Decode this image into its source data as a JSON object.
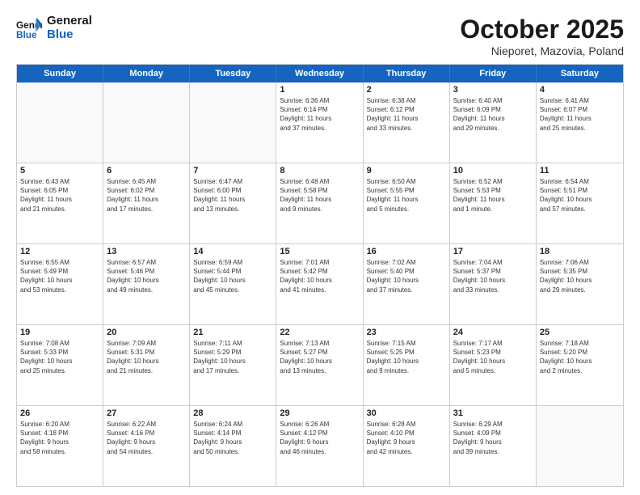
{
  "header": {
    "logo_line1": "General",
    "logo_line2": "Blue",
    "month": "October 2025",
    "location": "Nieporet, Mazovia, Poland"
  },
  "days_of_week": [
    "Sunday",
    "Monday",
    "Tuesday",
    "Wednesday",
    "Thursday",
    "Friday",
    "Saturday"
  ],
  "weeks": [
    [
      {
        "day": "",
        "info": ""
      },
      {
        "day": "",
        "info": ""
      },
      {
        "day": "",
        "info": ""
      },
      {
        "day": "1",
        "info": "Sunrise: 6:36 AM\nSunset: 6:14 PM\nDaylight: 11 hours\nand 37 minutes."
      },
      {
        "day": "2",
        "info": "Sunrise: 6:38 AM\nSunset: 6:12 PM\nDaylight: 11 hours\nand 33 minutes."
      },
      {
        "day": "3",
        "info": "Sunrise: 6:40 AM\nSunset: 6:09 PM\nDaylight: 11 hours\nand 29 minutes."
      },
      {
        "day": "4",
        "info": "Sunrise: 6:41 AM\nSunset: 6:07 PM\nDaylight: 11 hours\nand 25 minutes."
      }
    ],
    [
      {
        "day": "5",
        "info": "Sunrise: 6:43 AM\nSunset: 6:05 PM\nDaylight: 11 hours\nand 21 minutes."
      },
      {
        "day": "6",
        "info": "Sunrise: 6:45 AM\nSunset: 6:02 PM\nDaylight: 11 hours\nand 17 minutes."
      },
      {
        "day": "7",
        "info": "Sunrise: 6:47 AM\nSunset: 6:00 PM\nDaylight: 11 hours\nand 13 minutes."
      },
      {
        "day": "8",
        "info": "Sunrise: 6:48 AM\nSunset: 5:58 PM\nDaylight: 11 hours\nand 9 minutes."
      },
      {
        "day": "9",
        "info": "Sunrise: 6:50 AM\nSunset: 5:55 PM\nDaylight: 11 hours\nand 5 minutes."
      },
      {
        "day": "10",
        "info": "Sunrise: 6:52 AM\nSunset: 5:53 PM\nDaylight: 11 hours\nand 1 minute."
      },
      {
        "day": "11",
        "info": "Sunrise: 6:54 AM\nSunset: 5:51 PM\nDaylight: 10 hours\nand 57 minutes."
      }
    ],
    [
      {
        "day": "12",
        "info": "Sunrise: 6:55 AM\nSunset: 5:49 PM\nDaylight: 10 hours\nand 53 minutes."
      },
      {
        "day": "13",
        "info": "Sunrise: 6:57 AM\nSunset: 5:46 PM\nDaylight: 10 hours\nand 49 minutes."
      },
      {
        "day": "14",
        "info": "Sunrise: 6:59 AM\nSunset: 5:44 PM\nDaylight: 10 hours\nand 45 minutes."
      },
      {
        "day": "15",
        "info": "Sunrise: 7:01 AM\nSunset: 5:42 PM\nDaylight: 10 hours\nand 41 minutes."
      },
      {
        "day": "16",
        "info": "Sunrise: 7:02 AM\nSunset: 5:40 PM\nDaylight: 10 hours\nand 37 minutes."
      },
      {
        "day": "17",
        "info": "Sunrise: 7:04 AM\nSunset: 5:37 PM\nDaylight: 10 hours\nand 33 minutes."
      },
      {
        "day": "18",
        "info": "Sunrise: 7:06 AM\nSunset: 5:35 PM\nDaylight: 10 hours\nand 29 minutes."
      }
    ],
    [
      {
        "day": "19",
        "info": "Sunrise: 7:08 AM\nSunset: 5:33 PM\nDaylight: 10 hours\nand 25 minutes."
      },
      {
        "day": "20",
        "info": "Sunrise: 7:09 AM\nSunset: 5:31 PM\nDaylight: 10 hours\nand 21 minutes."
      },
      {
        "day": "21",
        "info": "Sunrise: 7:11 AM\nSunset: 5:29 PM\nDaylight: 10 hours\nand 17 minutes."
      },
      {
        "day": "22",
        "info": "Sunrise: 7:13 AM\nSunset: 5:27 PM\nDaylight: 10 hours\nand 13 minutes."
      },
      {
        "day": "23",
        "info": "Sunrise: 7:15 AM\nSunset: 5:25 PM\nDaylight: 10 hours\nand 9 minutes."
      },
      {
        "day": "24",
        "info": "Sunrise: 7:17 AM\nSunset: 5:23 PM\nDaylight: 10 hours\nand 5 minutes."
      },
      {
        "day": "25",
        "info": "Sunrise: 7:18 AM\nSunset: 5:20 PM\nDaylight: 10 hours\nand 2 minutes."
      }
    ],
    [
      {
        "day": "26",
        "info": "Sunrise: 6:20 AM\nSunset: 4:18 PM\nDaylight: 9 hours\nand 58 minutes."
      },
      {
        "day": "27",
        "info": "Sunrise: 6:22 AM\nSunset: 4:16 PM\nDaylight: 9 hours\nand 54 minutes."
      },
      {
        "day": "28",
        "info": "Sunrise: 6:24 AM\nSunset: 4:14 PM\nDaylight: 9 hours\nand 50 minutes."
      },
      {
        "day": "29",
        "info": "Sunrise: 6:26 AM\nSunset: 4:12 PM\nDaylight: 9 hours\nand 46 minutes."
      },
      {
        "day": "30",
        "info": "Sunrise: 6:28 AM\nSunset: 4:10 PM\nDaylight: 9 hours\nand 42 minutes."
      },
      {
        "day": "31",
        "info": "Sunrise: 6:29 AM\nSunset: 4:09 PM\nDaylight: 9 hours\nand 39 minutes."
      },
      {
        "day": "",
        "info": ""
      }
    ]
  ]
}
